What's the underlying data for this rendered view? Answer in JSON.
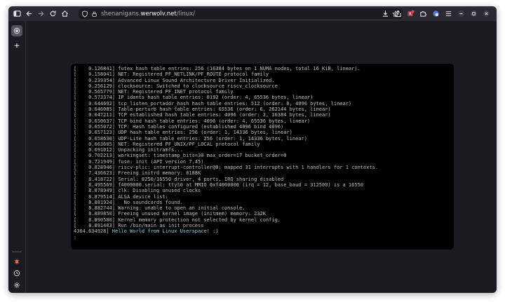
{
  "browser": {
    "url_pre": "shenanigans.",
    "url_domain": "werwolv.net",
    "url_path": "/linux/"
  },
  "terminal": {
    "lines": [
      "[    0.126841] futex hash table entries: 256 (16384 bytes on 1 NUMA nodes, total 16 KiB, linear).",
      "[    0.158041] NET: Registered PF_NETLINK/PF_ROUTE protocol family",
      "[    0.239354] Advanced Linux Sound Architecture Driver Initialized.",
      "[    0.256129] clocksource: Switched to clocksource riscv_clocksource",
      "[    0.565779] NET: Registered PF_INET protocol family",
      "[    0.573374] IP idents hash table entries: 8192 (order: 4, 65536 bytes, linear)",
      "[    0.644692] tcp_listen_portaddr_hash hash table entries: 512 (order: 0, 4096 bytes, linear)",
      "[    0.646085] Table-perturb hash table entries: 65536 (order: 6, 262144 bytes, linear)",
      "[    0.647211] TCP established hash table entries: 4096 (order: 2, 16384 bytes, linear)",
      "[    0.650637] TCP bind hash table entries: 4096 (order: 4, 65536 bytes, linear)",
      "[    0.655072] TCP: Hash tables configured (established 4096 bind 4096)",
      "[    0.657123] UDP hash table entries: 256 (order: 1, 14336 bytes, linear)",
      "[    0.658630] UDP-Lite hash table entries: 256 (order: 1, 14336 bytes, linear)",
      "[    0.663605] NET: Registered PF_UNIX/PF_LOCAL protocol family",
      "[    0.691012] Unpacking initramfs...",
      "[    0.702213] workingset: timestamp_bits=30 max_order=17 bucket_order=0",
      "[    0.721949] fuse: init (API version 7.45)",
      "[    0.828946] riscv-plic: interrupt-controller@0: mapped 31 interrupts with 1 handlers for 1 contexts.",
      "[    7.436623] Freeing initrd memory: 8188K",
      "[    8.418722] Serial: 8250/16550 driver, 4 ports, IRQ sharing disabled",
      "[    8.495569] f4000000.serial: ttyS0 at MMIO 0xf4000000 (irq = 12, base_baud = 312500) is a 16550",
      "[    8.878949] clk: Disabling unused clocks",
      "[    8.879514] ALSA device list:",
      "[    8.881924]   No soundcards found.",
      "[    8.882744] Warning: unable to open an initial console.",
      "[    8.889850] Freeing unused kernel image (initmem) memory: 232K",
      "[    8.890580] Kernel memory protection not selected by kernel config.",
      "[    8.891403] Run /bin/main as init process"
    ],
    "hello_stamp": "4364.634928]",
    "hello_text": " Hello World from Linux Userspace! :)",
    "cursor": "▯"
  }
}
